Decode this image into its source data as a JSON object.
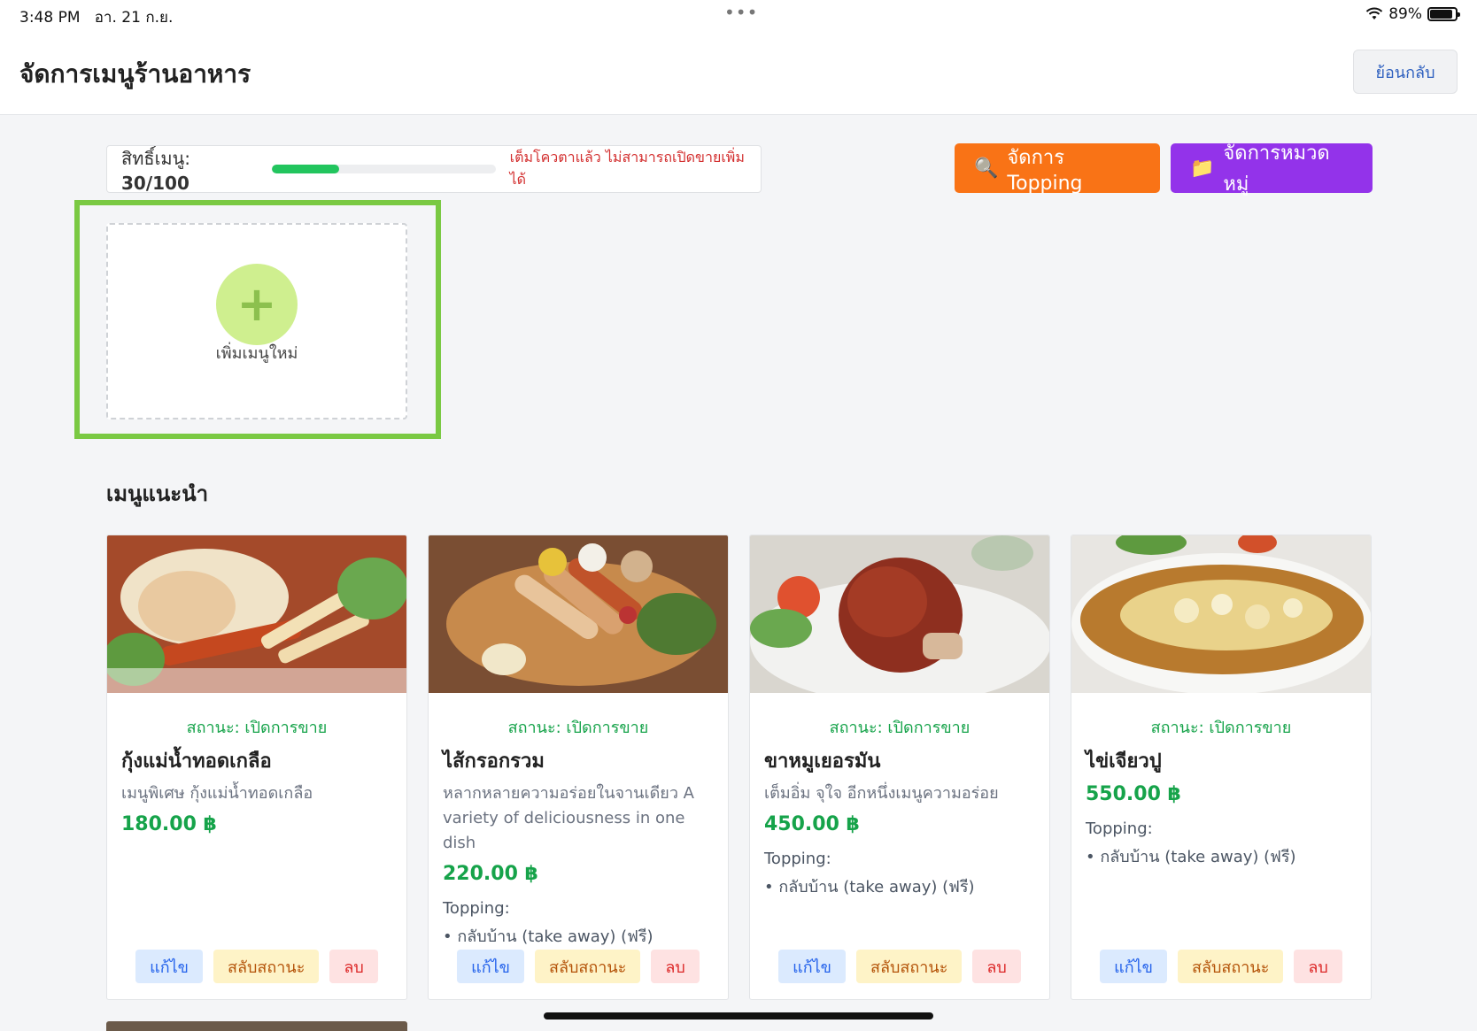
{
  "statusbar": {
    "time": "3:48 PM",
    "date": "อา. 21 ก.ย.",
    "battery": "89%",
    "battery_level": 0.89
  },
  "header": {
    "title": "จัดการเมนูร้านอาหาร",
    "back_label": "ย้อนกลับ"
  },
  "quota": {
    "label": "สิทธิ์เมนู:",
    "value": "30/100",
    "used": 30,
    "total": 100,
    "warning": "เต็มโควตาแล้ว ไม่สามารถเปิดขายเพิ่มได้"
  },
  "toolbar": {
    "topping_label": "จัดการ Topping",
    "topping_icon": "magnifier-icon",
    "category_label": "จัดการหมวดหมู่",
    "category_icon": "folder-icon"
  },
  "add_menu": {
    "label": "เพิ่มเมนูใหม่"
  },
  "section": {
    "title": "เมนูแนะนำ"
  },
  "cards": [
    {
      "status": "สถานะ: เปิดการขาย",
      "name": "กุ้งแม่น้ำทอดเกลือ",
      "desc": "เมนูพิเศษ กุ้งแม่น้ำทอดเกลือ",
      "price": "180.00 ฿",
      "topping_label": "",
      "topping_item": "",
      "edit": "แก้ไข",
      "toggle": "สลับสถานะ",
      "delete": "ลบ"
    },
    {
      "status": "สถานะ: เปิดการขาย",
      "name": "ไส้กรอกรวม",
      "desc": "หลากหลายความอร่อยในจานเดียว A variety of deliciousness in one dish",
      "price": "220.00 ฿",
      "topping_label": "Topping:",
      "topping_item": "• กลับบ้าน (take away) (ฟรี)",
      "edit": "แก้ไข",
      "toggle": "สลับสถานะ",
      "delete": "ลบ"
    },
    {
      "status": "สถานะ: เปิดการขาย",
      "name": "ขาหมูเยอรมัน",
      "desc": "เต็มอิ่ม จุใจ อีกหนึ่งเมนูความอร่อย",
      "price": "450.00 ฿",
      "topping_label": "Topping:",
      "topping_item": "• กลับบ้าน (take away) (ฟรี)",
      "edit": "แก้ไข",
      "toggle": "สลับสถานะ",
      "delete": "ลบ"
    },
    {
      "status": "สถานะ: เปิดการขาย",
      "name": "ไข่เจียวปู",
      "desc": "",
      "price": "550.00 ฿",
      "topping_label": "Topping:",
      "topping_item": "• กลับบ้าน (take away) (ฟรี)",
      "edit": "แก้ไข",
      "toggle": "สลับสถานะ",
      "delete": "ลบ"
    }
  ]
}
